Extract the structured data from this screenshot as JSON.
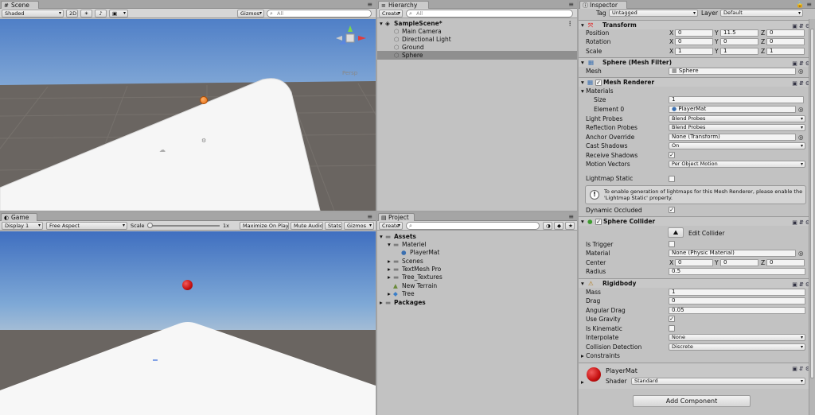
{
  "scene": {
    "tab": "Scene",
    "shading": "Shaded",
    "btn_2d": "2D",
    "gizmos": "Gizmos",
    "search": "All",
    "persp": "Persp"
  },
  "game": {
    "tab": "Game",
    "display": "Display 1",
    "aspect": "Free Aspect",
    "scale_label": "Scale",
    "scale_value": "1x",
    "maximize": "Maximize On Play",
    "mute": "Mute Audio",
    "stats": "Stats",
    "gizmos": "Gizmos"
  },
  "hierarchy": {
    "tab": "Hierarchy",
    "create": "Create",
    "search": "All",
    "scene_name": "SampleScene*",
    "items": [
      "Main Camera",
      "Directional Light",
      "Ground",
      "Sphere"
    ]
  },
  "project": {
    "tab": "Project",
    "create": "Create",
    "root": "Assets",
    "items": [
      {
        "label": "Materiel",
        "depth": 1,
        "arrow": "▾",
        "icon": "folder-icon"
      },
      {
        "label": "PlayerMat",
        "depth": 2,
        "arrow": "",
        "icon": "material-sphere-icon"
      },
      {
        "label": "Scenes",
        "depth": 1,
        "arrow": "▸",
        "icon": "folder-icon"
      },
      {
        "label": "TextMesh Pro",
        "depth": 1,
        "arrow": "▸",
        "icon": "folder-icon"
      },
      {
        "label": "Tree_Textures",
        "depth": 1,
        "arrow": "▸",
        "icon": "folder-icon"
      },
      {
        "label": "New Terrain",
        "depth": 1,
        "arrow": "",
        "icon": "terrain-icon"
      },
      {
        "label": "Tree",
        "depth": 1,
        "arrow": "▸",
        "icon": "tree-prefab-icon"
      }
    ],
    "packages": "Packages"
  },
  "inspector": {
    "tab": "Inspector",
    "tag_label": "Tag",
    "tag_value": "Untagged",
    "layer_label": "Layer",
    "layer_value": "Default",
    "transform": {
      "title": "Transform",
      "position": {
        "label": "Position",
        "x": "0",
        "y": "11.5",
        "z": "0"
      },
      "rotation": {
        "label": "Rotation",
        "x": "0",
        "y": "0",
        "z": "0"
      },
      "scale": {
        "label": "Scale",
        "x": "1",
        "y": "1",
        "z": "1"
      }
    },
    "mesh_filter": {
      "title": "Sphere (Mesh Filter)",
      "mesh_label": "Mesh",
      "mesh_value": "Sphere"
    },
    "mesh_renderer": {
      "title": "Mesh Renderer",
      "materials": "Materials",
      "size_label": "Size",
      "size_value": "1",
      "element0_label": "Element 0",
      "element0_value": "PlayerMat",
      "light_probes_label": "Light Probes",
      "light_probes_value": "Blend Probes",
      "reflection_probes_label": "Reflection Probes",
      "reflection_probes_value": "Blend Probes",
      "anchor_override_label": "Anchor Override",
      "anchor_override_value": "None (Transform)",
      "cast_shadows_label": "Cast Shadows",
      "cast_shadows_value": "On",
      "receive_shadows_label": "Receive Shadows",
      "motion_vectors_label": "Motion Vectors",
      "motion_vectors_value": "Per Object Motion",
      "lightmap_static_label": "Lightmap Static",
      "info": "To enable generation of lightmaps for this Mesh Renderer, please enable the 'Lightmap Static' property.",
      "dynamic_occluded_label": "Dynamic Occluded"
    },
    "sphere_collider": {
      "title": "Sphere Collider",
      "edit": "Edit Collider",
      "is_trigger_label": "Is Trigger",
      "material_label": "Material",
      "material_value": "None (Physic Material)",
      "center_label": "Center",
      "center": {
        "x": "0",
        "y": "0",
        "z": "0"
      },
      "radius_label": "Radius",
      "radius_value": "0.5"
    },
    "rigidbody": {
      "title": "Rigidbody",
      "mass_label": "Mass",
      "mass_value": "1",
      "drag_label": "Drag",
      "drag_value": "0",
      "angular_drag_label": "Angular Drag",
      "angular_drag_value": "0.05",
      "use_gravity_label": "Use Gravity",
      "is_kinematic_label": "Is Kinematic",
      "interpolate_label": "Interpolate",
      "interpolate_value": "None",
      "collision_label": "Collision Detection",
      "collision_value": "Discrete",
      "constraints_label": "Constraints"
    },
    "material": {
      "name": "PlayerMat",
      "shader_label": "Shader",
      "shader_value": "Standard"
    },
    "add_component": "Add Component"
  },
  "colors": {
    "sphere": "#d51a1a",
    "sky": "#7fa9d6",
    "ground": "#6a6561"
  }
}
